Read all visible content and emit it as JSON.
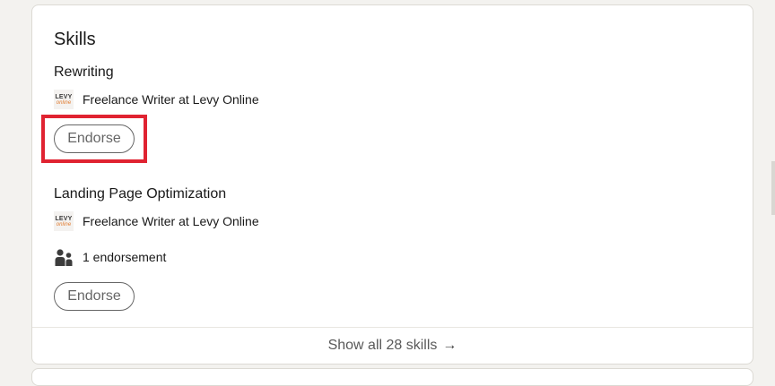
{
  "section": {
    "title": "Skills"
  },
  "skills": [
    {
      "name": "Rewriting",
      "position": "Freelance Writer at Levy Online",
      "endorse_label": "Endorse"
    },
    {
      "name": "Landing Page Optimization",
      "position": "Freelance Writer at Levy Online",
      "endorsements": "1 endorsement",
      "endorse_label": "Endorse"
    }
  ],
  "logo": {
    "line1": "LEVY",
    "line2": "online"
  },
  "footer": {
    "label": "Show all 28 skills",
    "arrow": "→"
  },
  "colors": {
    "highlight": "#e02331",
    "background": "#f3f2ef"
  }
}
